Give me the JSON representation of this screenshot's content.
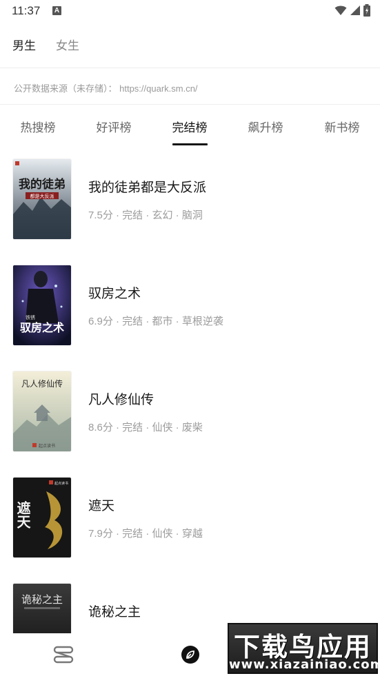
{
  "status_bar": {
    "time": "11:37",
    "notif_letter": "A"
  },
  "gender_tabs": {
    "male": "男生",
    "female": "女生",
    "active": "male"
  },
  "source_note": "公开数据来源（未存储）： https://quark.sm.cn/",
  "rank_tabs": [
    {
      "label": "热搜榜"
    },
    {
      "label": "好评榜"
    },
    {
      "label": "完结榜",
      "active": true
    },
    {
      "label": "飙升榜"
    },
    {
      "label": "新书榜"
    }
  ],
  "books": [
    {
      "title": "我的徒弟都是大反派",
      "meta": "7.5分 · 完结 · 玄幻 · 脑洞",
      "cover_text": "我的徒弟",
      "cover_sub": "都是大反派",
      "cover_colors": [
        "#dfe6ea",
        "#3b4a58"
      ]
    },
    {
      "title": "驭房之术",
      "meta": "6.9分 · 完结 · 都市 · 草根逆袭",
      "cover_text": "驭房之术",
      "cover_sub": "铁锈",
      "cover_colors": [
        "#1a1d3a",
        "#4b3a86"
      ]
    },
    {
      "title": "凡人修仙传",
      "meta": "8.6分 · 完结 · 仙侠 · 废柴",
      "cover_text": "凡人修仙传",
      "cover_sub": "起点读书",
      "cover_colors": [
        "#efe8cf",
        "#9fb0a0"
      ]
    },
    {
      "title": "遮天",
      "meta": "7.9分 · 完结 · 仙侠 · 穿越",
      "cover_text": "遮天",
      "cover_sub": "起点读书",
      "cover_colors": [
        "#1b1b1b",
        "#c9a23a"
      ]
    },
    {
      "title": "诡秘之主",
      "meta": "",
      "cover_text": "诡秘之主",
      "cover_sub": "",
      "cover_colors": [
        "#2a2a2a",
        "#555555"
      ]
    }
  ],
  "bottom_nav": {
    "shelf_icon": "bookshelf-icon",
    "discover_icon": "compass-icon"
  },
  "watermark": {
    "top": "下载鸟应用",
    "bottom": "www.xiazainiao.com"
  }
}
